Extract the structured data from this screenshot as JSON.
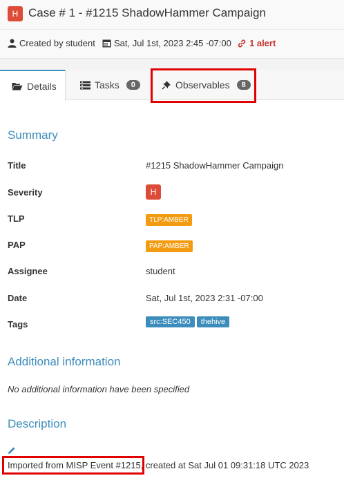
{
  "header": {
    "severity_badge": "H",
    "title": "Case # 1 - #1215 ShadowHammer Campaign"
  },
  "meta": {
    "created_by": "Created by student",
    "created_date": "Sat, Jul 1st, 2023 2:45 -07:00",
    "alert": "1 alert"
  },
  "tabs": [
    {
      "label": "Details",
      "icon": "folder-open-icon"
    },
    {
      "label": "Tasks",
      "count": "0",
      "icon": "tasks-icon"
    },
    {
      "label": "Observables",
      "count": "8",
      "icon": "pin-icon"
    }
  ],
  "summary": {
    "heading": "Summary",
    "rows": [
      {
        "label": "Title",
        "value": "#1215 ShadowHammer Campaign"
      },
      {
        "label": "Severity",
        "value": "H"
      },
      {
        "label": "TLP",
        "value": "TLP:AMBER"
      },
      {
        "label": "PAP",
        "value": "PAP:AMBER"
      },
      {
        "label": "Assignee",
        "value": "student"
      },
      {
        "label": "Date",
        "value": "Sat, Jul 1st, 2023 2:31 -07:00"
      },
      {
        "label": "Tags",
        "tags": [
          "src:SEC450",
          "thehive"
        ]
      }
    ]
  },
  "additional": {
    "heading": "Additional information",
    "note": "No additional information have been specified"
  },
  "description": {
    "heading": "Description",
    "text_part1": "Imported from MISP Event #1215",
    "text_part2": ", created at Sat Jul 01 09:31:18 UTC 2023"
  },
  "colors": {
    "accent": "#3c8dbc",
    "severity_high": "#dd4b39",
    "amber": "#f39c12",
    "highlight_box": "#e00000"
  }
}
